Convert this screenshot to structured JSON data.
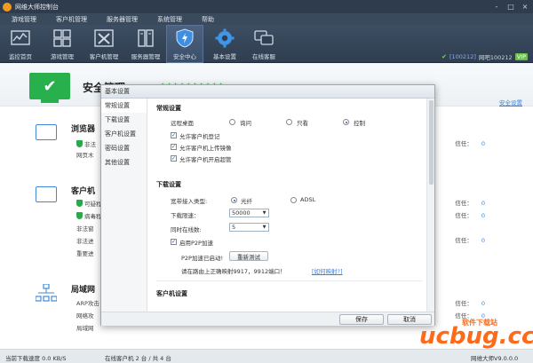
{
  "window": {
    "title": "网维大师控制台",
    "controls": [
      "-",
      "□",
      "×"
    ]
  },
  "menubar": [
    "游戏管理",
    "客户机管理",
    "服务器管理",
    "系统管理",
    "帮助"
  ],
  "toolbar": {
    "tools": [
      {
        "label": "监控首页",
        "icon": "monitor-chart-icon"
      },
      {
        "label": "游戏管理",
        "icon": "game-grid-icon"
      },
      {
        "label": "客户机管理",
        "icon": "tools-icon"
      },
      {
        "label": "服务器管理",
        "icon": "server-icon"
      },
      {
        "label": "安全中心",
        "icon": "shield-bolt-icon"
      },
      {
        "label": "基本设置",
        "icon": "gear-icon"
      },
      {
        "label": "在线客服",
        "icon": "chat-icon"
      }
    ],
    "right": {
      "account": "[100212]",
      "name": "网吧100212",
      "vip": "VIP"
    }
  },
  "hero": {
    "title": "安全管理",
    "link": "安全设置",
    "accent": "#27b04b"
  },
  "sections": [
    {
      "title": "浏览器",
      "rows": [
        "非法",
        "网页木"
      ],
      "trust": {
        "label": "信任：",
        "value": "0"
      }
    },
    {
      "title": "客户机",
      "rows": [
        "可疑程",
        "病毒程",
        "非法窗",
        "非法进",
        "重要进"
      ],
      "trust": {
        "label": "信任：",
        "value": "0"
      }
    },
    {
      "title": "局域网",
      "rows": [
        "ARP攻击",
        "网络攻",
        "局域网"
      ],
      "trust": {
        "label": "信任：",
        "value": "0"
      }
    }
  ],
  "trust_extra": [
    {
      "label": "信任：",
      "value": "0"
    },
    {
      "label": "信任：",
      "value": "0"
    },
    {
      "label": "信任：",
      "value": "0"
    }
  ],
  "statusbar": {
    "speed": "当前下载速度 0.0 KB/S",
    "clients": "在线客户机 2 台 / 共 4 台",
    "version": "网维大师V9.0.0.0"
  },
  "dialog": {
    "title": "基本设置",
    "nav": [
      "常规设置",
      "下载设置",
      "客户机设置",
      "密码设置",
      "其他设置"
    ],
    "general": {
      "heading": "常规设置",
      "remote_label": "远程桌面",
      "remote_options": [
        "询问",
        "只看",
        "控制"
      ],
      "remote_selected": 2,
      "checks": [
        "允许客户机登记",
        "允许客户机上传镜像",
        "允许客户机开启超管"
      ]
    },
    "download": {
      "heading": "下载设置",
      "broadband_label": "宽带接入类型:",
      "broadband_options": [
        "光纤",
        "ADSL"
      ],
      "broadband_selected": 0,
      "limit_label": "下载限速：",
      "limit_value": "50000",
      "tasks_label": "同时在线数:",
      "tasks_value": "5",
      "p2p_label": "启用P2P加速",
      "p2p_status": "P2P加速已启动!",
      "retest": "重新测试",
      "port_hint": "请在路由上正确映射9917，9912端口！",
      "port_link": "[如何映射?]"
    },
    "client_heading": "客户机设置",
    "buttons": {
      "save": "保存",
      "cancel": "取消"
    }
  },
  "watermark": {
    "logo": "ucbug.cc",
    "sub": "软件下载站"
  }
}
